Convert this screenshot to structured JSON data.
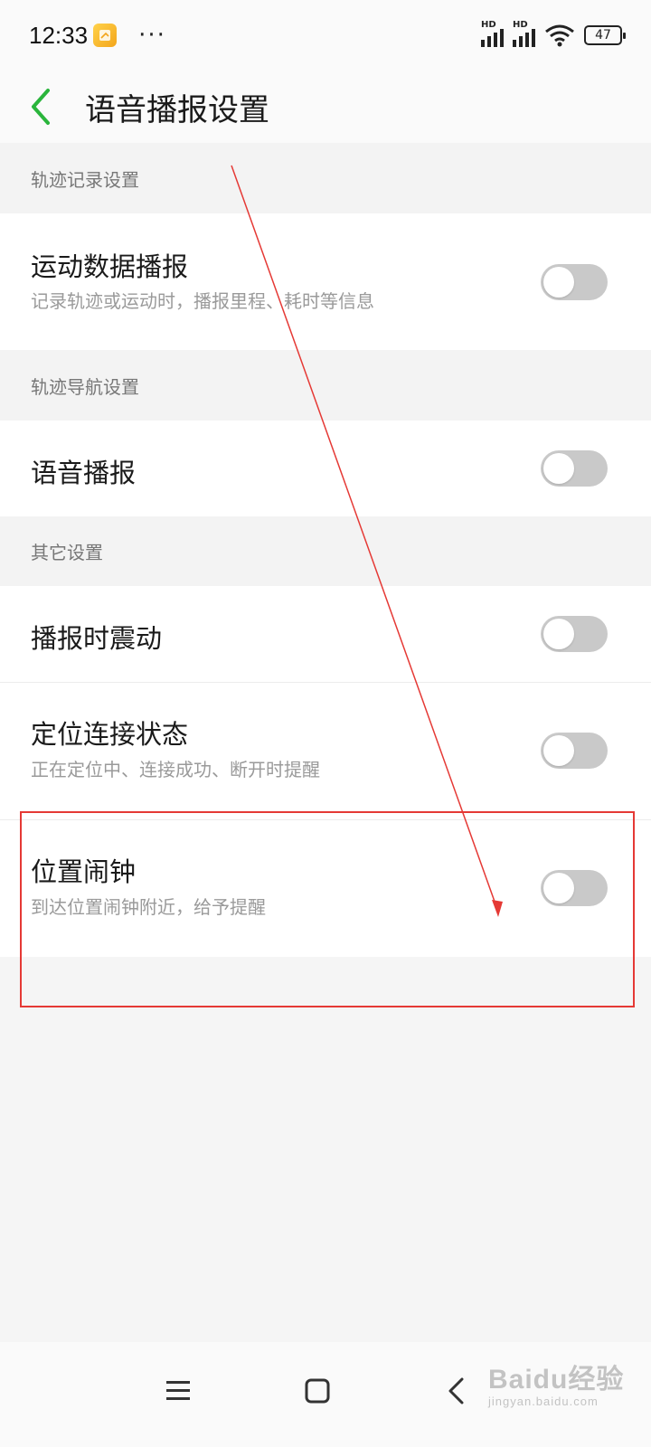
{
  "status_bar": {
    "time": "12:33",
    "more": "···",
    "battery": "47"
  },
  "header": {
    "title": "语音播报设置"
  },
  "sections": [
    {
      "header": "轨迹记录设置"
    },
    {
      "header": "轨迹导航设置"
    },
    {
      "header": "其它设置"
    }
  ],
  "rows": [
    {
      "title": "运动数据播报",
      "subtitle": "记录轨迹或运动时，播报里程、耗时等信息",
      "enabled": false
    },
    {
      "title": "语音播报",
      "enabled": false
    },
    {
      "title": "播报时震动",
      "enabled": false
    },
    {
      "title": "定位连接状态",
      "subtitle": "正在定位中、连接成功、断开时提醒",
      "enabled": false
    },
    {
      "title": "位置闹钟",
      "subtitle": "到达位置闹钟附近，给予提醒",
      "enabled": false
    }
  ],
  "watermark": {
    "logo": "Baidu经验",
    "url": "jingyan.baidu.com"
  },
  "colors": {
    "accent": "#2ab53c",
    "toggle_off": "#c9c9c9",
    "annotation": "#e53935"
  }
}
